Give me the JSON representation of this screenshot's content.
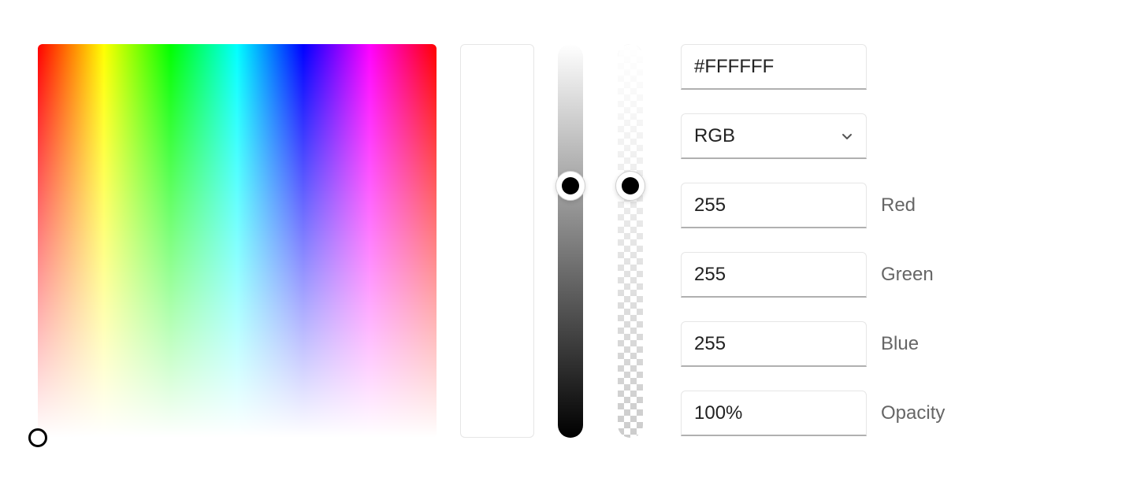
{
  "hex_value": "#FFFFFF",
  "colorspace_selected": "RGB",
  "channels": {
    "red": {
      "label": "Red",
      "value": "255"
    },
    "green": {
      "label": "Green",
      "value": "255"
    },
    "blue": {
      "label": "Blue",
      "value": "255"
    }
  },
  "opacity": {
    "label": "Opacity",
    "value": "100%"
  },
  "swatch_color": "#FFFFFF"
}
